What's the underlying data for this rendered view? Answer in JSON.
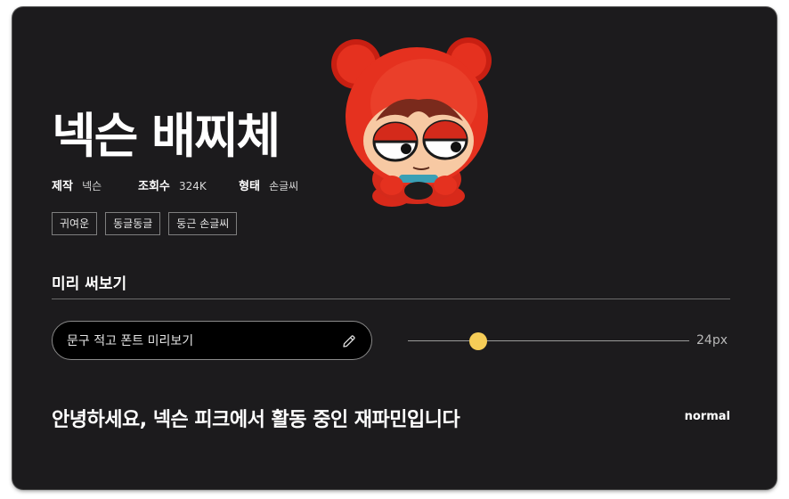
{
  "font": {
    "title": "넥슨 배찌체",
    "meta": [
      {
        "label": "제작",
        "value": "넥슨"
      },
      {
        "label": "조회수",
        "value": "324K"
      },
      {
        "label": "형태",
        "value": "손글씨"
      }
    ],
    "tags": [
      "귀여운",
      "동글동글",
      "둥근 손글씨"
    ],
    "mascot_icon": "bazzi-character-illustration"
  },
  "preview": {
    "heading": "미리 써보기",
    "input_placeholder": "문구 적고 폰트 미리보기",
    "input_value": "",
    "size_label": "24px",
    "size_level": 0.25,
    "sample_text": "안녕하세요, 넥슨 피크에서 활동 중인 재파민입니다",
    "weight_label": "normal"
  },
  "colors": {
    "card_background": "#1c1b1d",
    "slider_thumb": "#f6cd57",
    "mascot_red": "#e5311f"
  }
}
